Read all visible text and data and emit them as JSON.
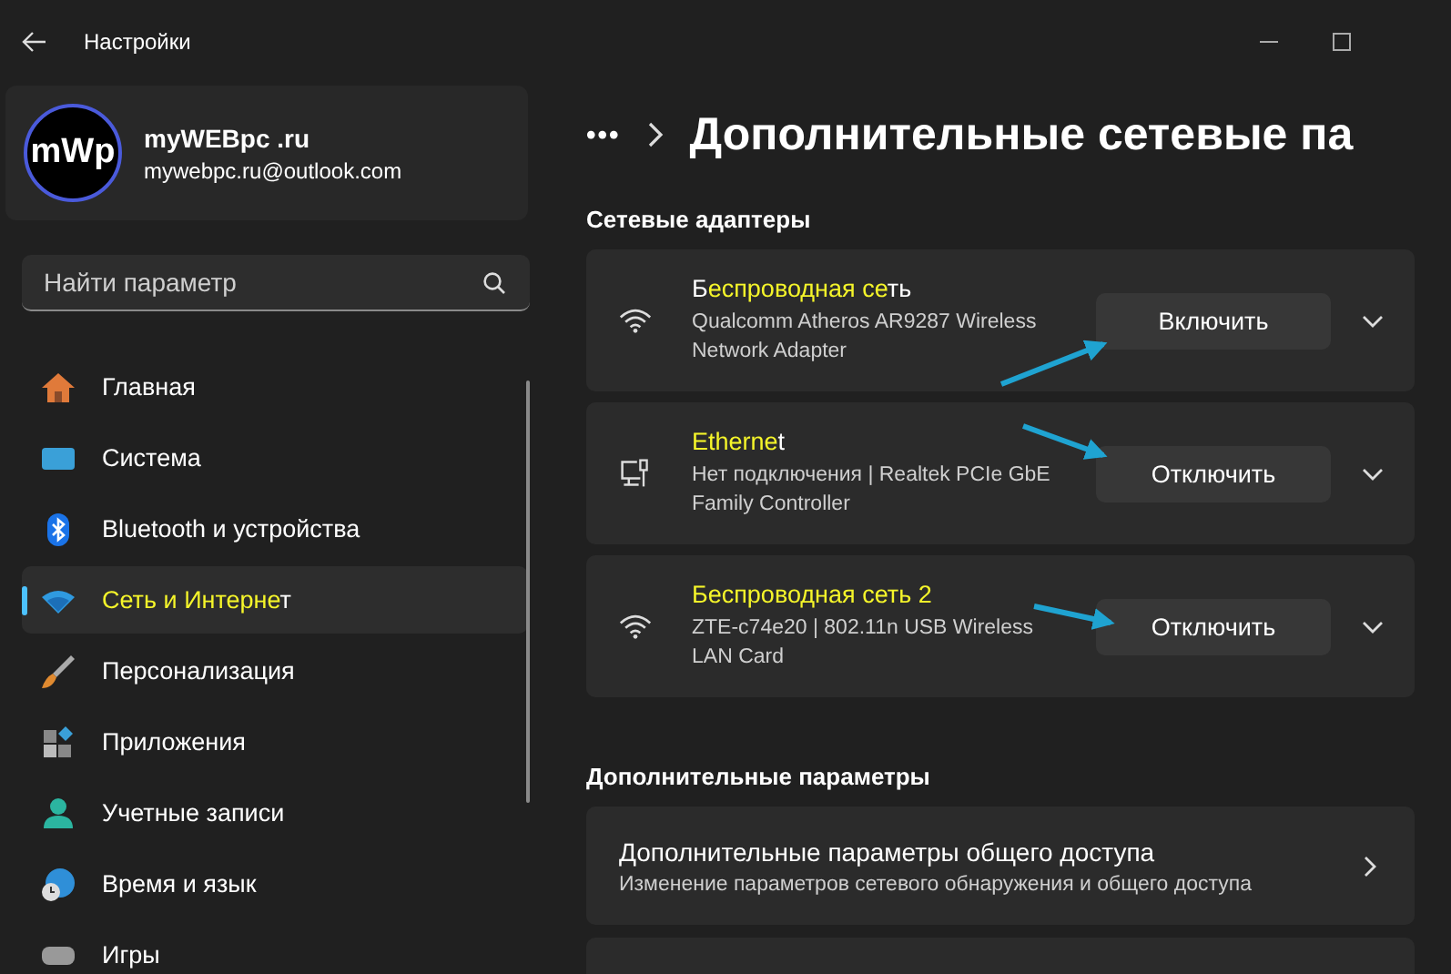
{
  "window": {
    "title": "Настройки"
  },
  "profile": {
    "avatar_text": "mWp",
    "name": "myWEBpc .ru",
    "email": "mywebpc.ru@outlook.com"
  },
  "search": {
    "placeholder": "Найти параметр"
  },
  "sidebar": {
    "items": [
      {
        "kind": "home",
        "parts": [
          {
            "text": "Главная",
            "marked": false
          }
        ],
        "selected": false
      },
      {
        "kind": "system",
        "parts": [
          {
            "text": "Система",
            "marked": false
          }
        ],
        "selected": false
      },
      {
        "kind": "bluetooth",
        "parts": [
          {
            "text": "Bluetooth и устройства",
            "marked": false
          }
        ],
        "selected": false
      },
      {
        "kind": "network",
        "parts": [
          {
            "text": "Сеть и Интерне",
            "marked": true
          },
          {
            "text": "т",
            "marked": false
          }
        ],
        "selected": true
      },
      {
        "kind": "brush",
        "parts": [
          {
            "text": "Персонализация",
            "marked": false
          }
        ],
        "selected": false
      },
      {
        "kind": "apps",
        "parts": [
          {
            "text": "Приложения",
            "marked": false
          }
        ],
        "selected": false
      },
      {
        "kind": "accounts",
        "parts": [
          {
            "text": "Учетные записи",
            "marked": false
          }
        ],
        "selected": false
      },
      {
        "kind": "time",
        "parts": [
          {
            "text": "Время и язык",
            "marked": false
          }
        ],
        "selected": false
      },
      {
        "kind": "games",
        "parts": [
          {
            "text": "Игры",
            "marked": false
          }
        ],
        "selected": false
      }
    ]
  },
  "header": {
    "breadcrumb_more": "•••",
    "title": "Дополнительные сетевые па"
  },
  "adapters_section": {
    "title": "Сетевые адаптеры"
  },
  "adapters": [
    {
      "kind": "wifi",
      "title_parts": [
        {
          "text": "Б",
          "marked": false
        },
        {
          "text": "еспроводная се",
          "marked": true
        },
        {
          "text": "ть",
          "marked": false
        }
      ],
      "description": "Qualcomm Atheros AR9287 Wireless Network Adapter",
      "button": "Включить"
    },
    {
      "kind": "ethernet",
      "title_parts": [
        {
          "text": "Etherne",
          "marked": true
        },
        {
          "text": "t",
          "marked": false
        }
      ],
      "description": "Нет подключения | Realtek PCIe GbE Family Controller",
      "button": "Отключить"
    },
    {
      "kind": "wifi",
      "title_parts": [
        {
          "text": "Беспроводная сеть 2",
          "marked": true
        }
      ],
      "description": "ZTE-c74e20 | 802.11n USB Wireless LAN Card",
      "button": "Отключить"
    }
  ],
  "more_section": {
    "title": "Дополнительные параметры"
  },
  "more_items": [
    {
      "title": "Дополнительные параметры общего доступа",
      "description": "Изменение параметров сетевого обнаружения и общего доступа"
    }
  ]
}
